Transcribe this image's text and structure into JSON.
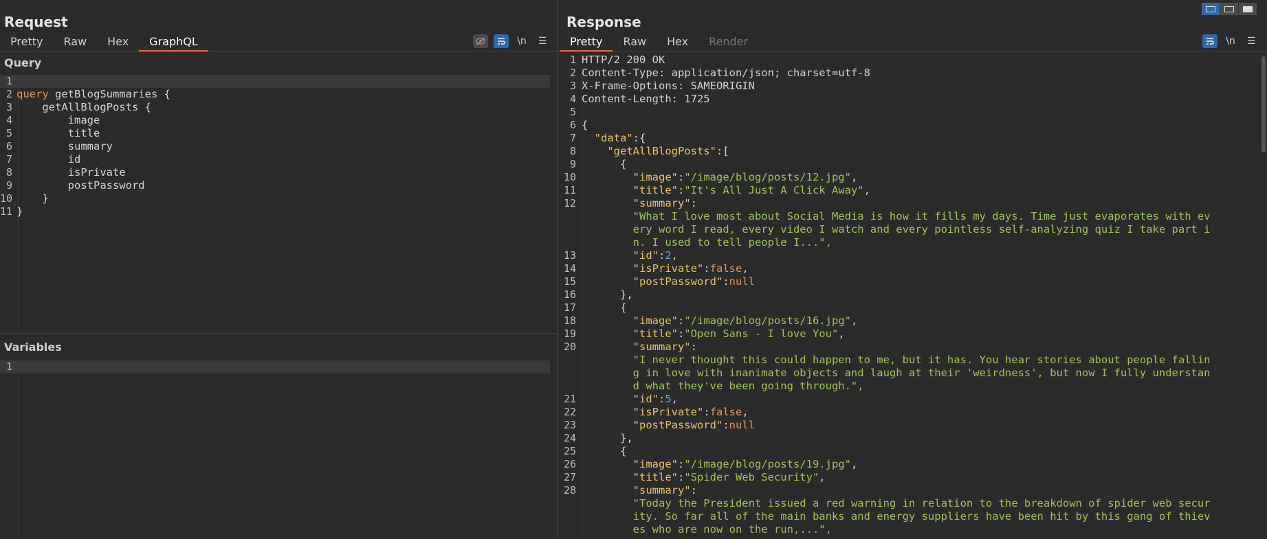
{
  "request": {
    "title": "Request",
    "tabs": [
      "Pretty",
      "Raw",
      "Hex",
      "GraphQL"
    ],
    "active_tab": "GraphQL",
    "toolbar": {
      "newline_label": "\\n"
    },
    "query_label": "Query",
    "variables_label": "Variables",
    "query_lines": [
      "",
      "query getBlogSummaries {",
      "    getAllBlogPosts {",
      "        image",
      "        title",
      "        summary",
      "        id",
      "        isPrivate",
      "        postPassword",
      "    }",
      "}"
    ],
    "variables_lines": [
      ""
    ]
  },
  "response": {
    "title": "Response",
    "tabs": [
      "Pretty",
      "Raw",
      "Hex",
      "Render"
    ],
    "active_tab": "Pretty",
    "toolbar": {
      "newline_label": "\\n"
    },
    "lines": [
      {
        "n": "1",
        "text": "HTTP/2 200 OK"
      },
      {
        "n": "2",
        "text": "Content-Type: application/json; charset=utf-8"
      },
      {
        "n": "3",
        "text": "X-Frame-Options: SAMEORIGIN"
      },
      {
        "n": "4",
        "text": "Content-Length: 1725"
      },
      {
        "n": "5",
        "text": ""
      },
      {
        "n": "6",
        "text": "{"
      },
      {
        "n": "7",
        "text": "  \"data\":{"
      },
      {
        "n": "8",
        "text": "    \"getAllBlogPosts\":["
      },
      {
        "n": "9",
        "text": "      {"
      },
      {
        "n": "10",
        "text": "        \"image\":\"/image/blog/posts/12.jpg\","
      },
      {
        "n": "11",
        "text": "        \"title\":\"It's All Just A Click Away\","
      },
      {
        "n": "12",
        "text": "        \"summary\":"
      },
      {
        "n": "",
        "text": "        \"What I love most about Social Media is how it fills my days. Time just evaporates with ev"
      },
      {
        "n": "",
        "text": "        ery word I read, every video I watch and every pointless self-analyzing quiz I take part i"
      },
      {
        "n": "",
        "text": "        n. I used to tell people I...\","
      },
      {
        "n": "13",
        "text": "        \"id\":2,"
      },
      {
        "n": "14",
        "text": "        \"isPrivate\":false,"
      },
      {
        "n": "15",
        "text": "        \"postPassword\":null"
      },
      {
        "n": "16",
        "text": "      },"
      },
      {
        "n": "17",
        "text": "      {"
      },
      {
        "n": "18",
        "text": "        \"image\":\"/image/blog/posts/16.jpg\","
      },
      {
        "n": "19",
        "text": "        \"title\":\"Open Sans - I love You\","
      },
      {
        "n": "20",
        "text": "        \"summary\":"
      },
      {
        "n": "",
        "text": "        \"I never thought this could happen to me, but it has. You hear stories about people fallin"
      },
      {
        "n": "",
        "text": "        g in love with inanimate objects and laugh at their 'weirdness', but now I fully understan"
      },
      {
        "n": "",
        "text": "        d what they've been going through.\","
      },
      {
        "n": "21",
        "text": "        \"id\":5,"
      },
      {
        "n": "22",
        "text": "        \"isPrivate\":false,"
      },
      {
        "n": "23",
        "text": "        \"postPassword\":null"
      },
      {
        "n": "24",
        "text": "      },"
      },
      {
        "n": "25",
        "text": "      {"
      },
      {
        "n": "26",
        "text": "        \"image\":\"/image/blog/posts/19.jpg\","
      },
      {
        "n": "27",
        "text": "        \"title\":\"Spider Web Security\","
      },
      {
        "n": "28",
        "text": "        \"summary\":"
      },
      {
        "n": "",
        "text": "        \"Today the President issued a red warning in relation to the breakdown of spider web secur"
      },
      {
        "n": "",
        "text": "        ity. So far all of the main banks and energy suppliers have been hit by this gang of thiev"
      },
      {
        "n": "",
        "text": "        es who are now on the run,...\","
      }
    ]
  },
  "colors": {
    "accent": "#e36a3b",
    "blue": "#2f6aa8"
  }
}
